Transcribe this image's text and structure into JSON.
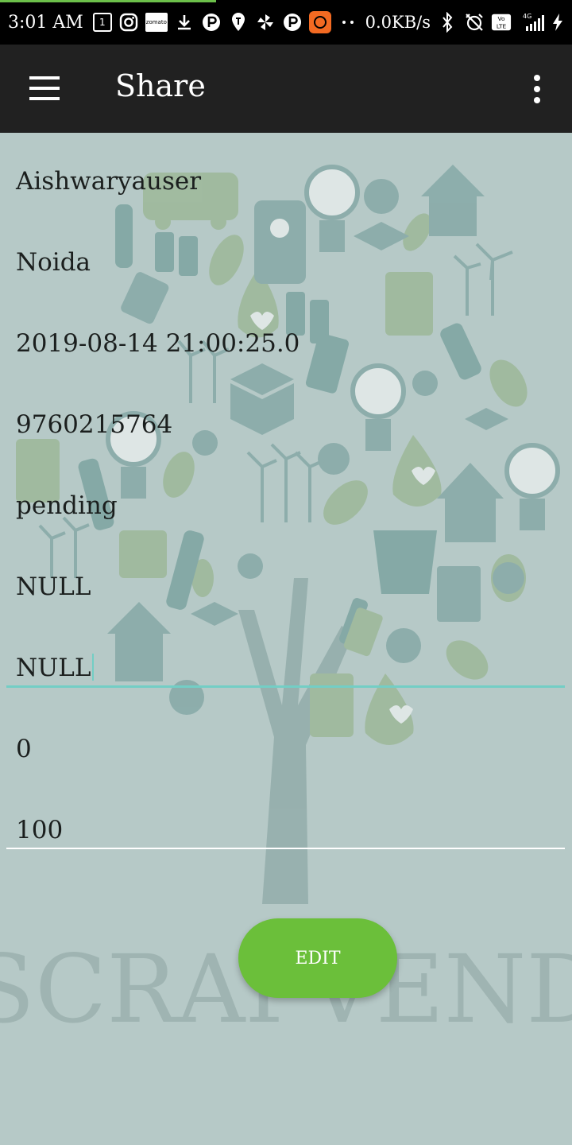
{
  "status_bar": {
    "time": "3:01 AM",
    "calendar_day": "1",
    "network_speed": "0.0KB/s",
    "network_type": "4G",
    "volte": "Vo LTE",
    "icons": [
      "calendar-icon",
      "instagram-icon",
      "zomato-icon",
      "download-icon",
      "paytm-icon",
      "swiggy-icon",
      "pinwheel-icon",
      "paytm-icon",
      "app-icon",
      "more-notifications-icon",
      "bluetooth-icon",
      "alarm-off-icon",
      "volte-icon",
      "signal-icon",
      "charging-icon"
    ],
    "zomato_label": "zomato"
  },
  "app_bar": {
    "title": "Share",
    "background": "#212121"
  },
  "fields": {
    "name": "Aishwaryauser",
    "city": "Noida",
    "datetime": "2019-08-14 21:00:25.0",
    "phone": "9760215764",
    "status": "pending",
    "field6": "NULL",
    "field7": "NULL",
    "field8": "0",
    "field9": "100"
  },
  "edit_button": {
    "label": "EDIT",
    "color": "#6bbf3a"
  },
  "watermark": {
    "text": "SCRAPVEND"
  },
  "colors": {
    "background": "#b6c9c7",
    "accent": "#73cec5",
    "art_teal": "#5e8f8c",
    "art_green": "#8fae7f"
  }
}
